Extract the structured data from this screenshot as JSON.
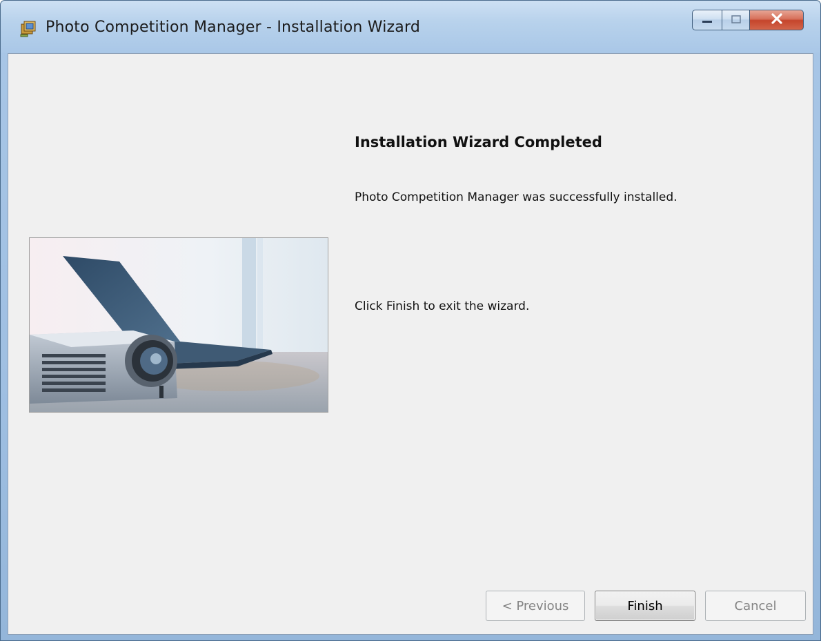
{
  "window": {
    "title": "Photo Competition Manager - Installation Wizard",
    "app_icon": "installer-icon"
  },
  "caption_buttons": {
    "minimize_icon": "minimize-icon",
    "maximize_icon": "maximize-icon",
    "close_icon": "close-icon"
  },
  "wizard": {
    "heading": "Installation Wizard Completed",
    "success_message": "Photo Competition Manager was successfully installed.",
    "exit_instruction": "Click Finish to exit the wizard.",
    "hero_image": "projector-and-laptop-photo"
  },
  "buttons": {
    "previous_label": "< Previous",
    "finish_label": "Finish",
    "cancel_label": "Cancel",
    "previous_enabled": false,
    "finish_enabled": true,
    "cancel_enabled": false
  },
  "colors": {
    "title_bar": "#a9c7e7",
    "close_button": "#c5452c",
    "dialog_background": "#f0f0f0"
  }
}
